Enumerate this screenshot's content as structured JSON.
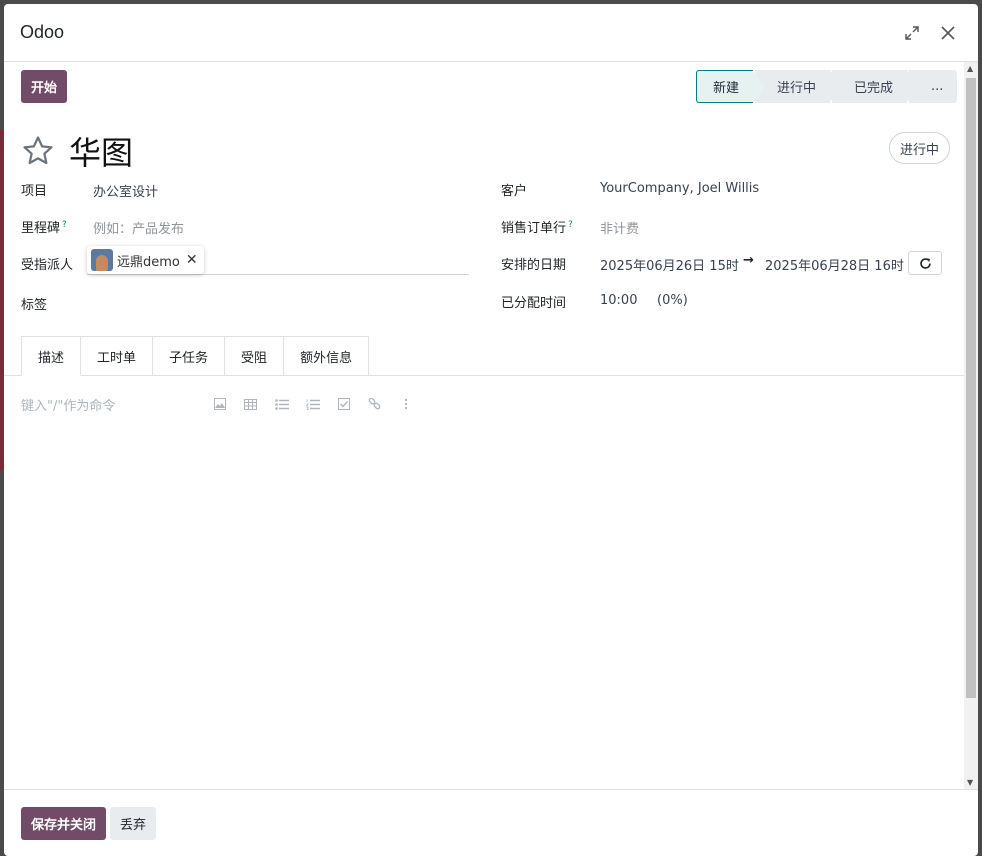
{
  "modal": {
    "title": "Odoo"
  },
  "header": {
    "start_label": "开始"
  },
  "statusbar": {
    "stages": [
      "新建",
      "进行中",
      "已完成",
      "..."
    ]
  },
  "task": {
    "title": "华图",
    "state": "进行中"
  },
  "fields": {
    "project_label": "项目",
    "project_value": "办公室设计",
    "milestone_label": "里程碑",
    "milestone_help": "?",
    "milestone_placeholder": "例如：产品发布",
    "assignee_label": "受指派人",
    "assignee_value": "远鼎demo",
    "tags_label": "标签",
    "customer_label": "客户",
    "customer_value": "YourCompany, Joel Willis",
    "sale_line_label": "销售订单行",
    "sale_line_help": "?",
    "sale_line_placeholder": "非计费",
    "dates_label": "安排的日期",
    "date_start": "2025年06月26日 15时",
    "date_arrow": "→",
    "date_end": "2025年06月28日 16时",
    "allocated_label": "已分配时间",
    "allocated_hours": "10:00",
    "allocated_percent": "(0%)"
  },
  "tabs": [
    "描述",
    "工时单",
    "子任务",
    "受阻",
    "额外信息"
  ],
  "editor": {
    "placeholder": "键入\"/\"作为命令"
  },
  "footer": {
    "save_label": "保存并关闭",
    "discard_label": "丢弃"
  },
  "colors": {
    "primary": "#714b67",
    "accent": "#017e84"
  }
}
